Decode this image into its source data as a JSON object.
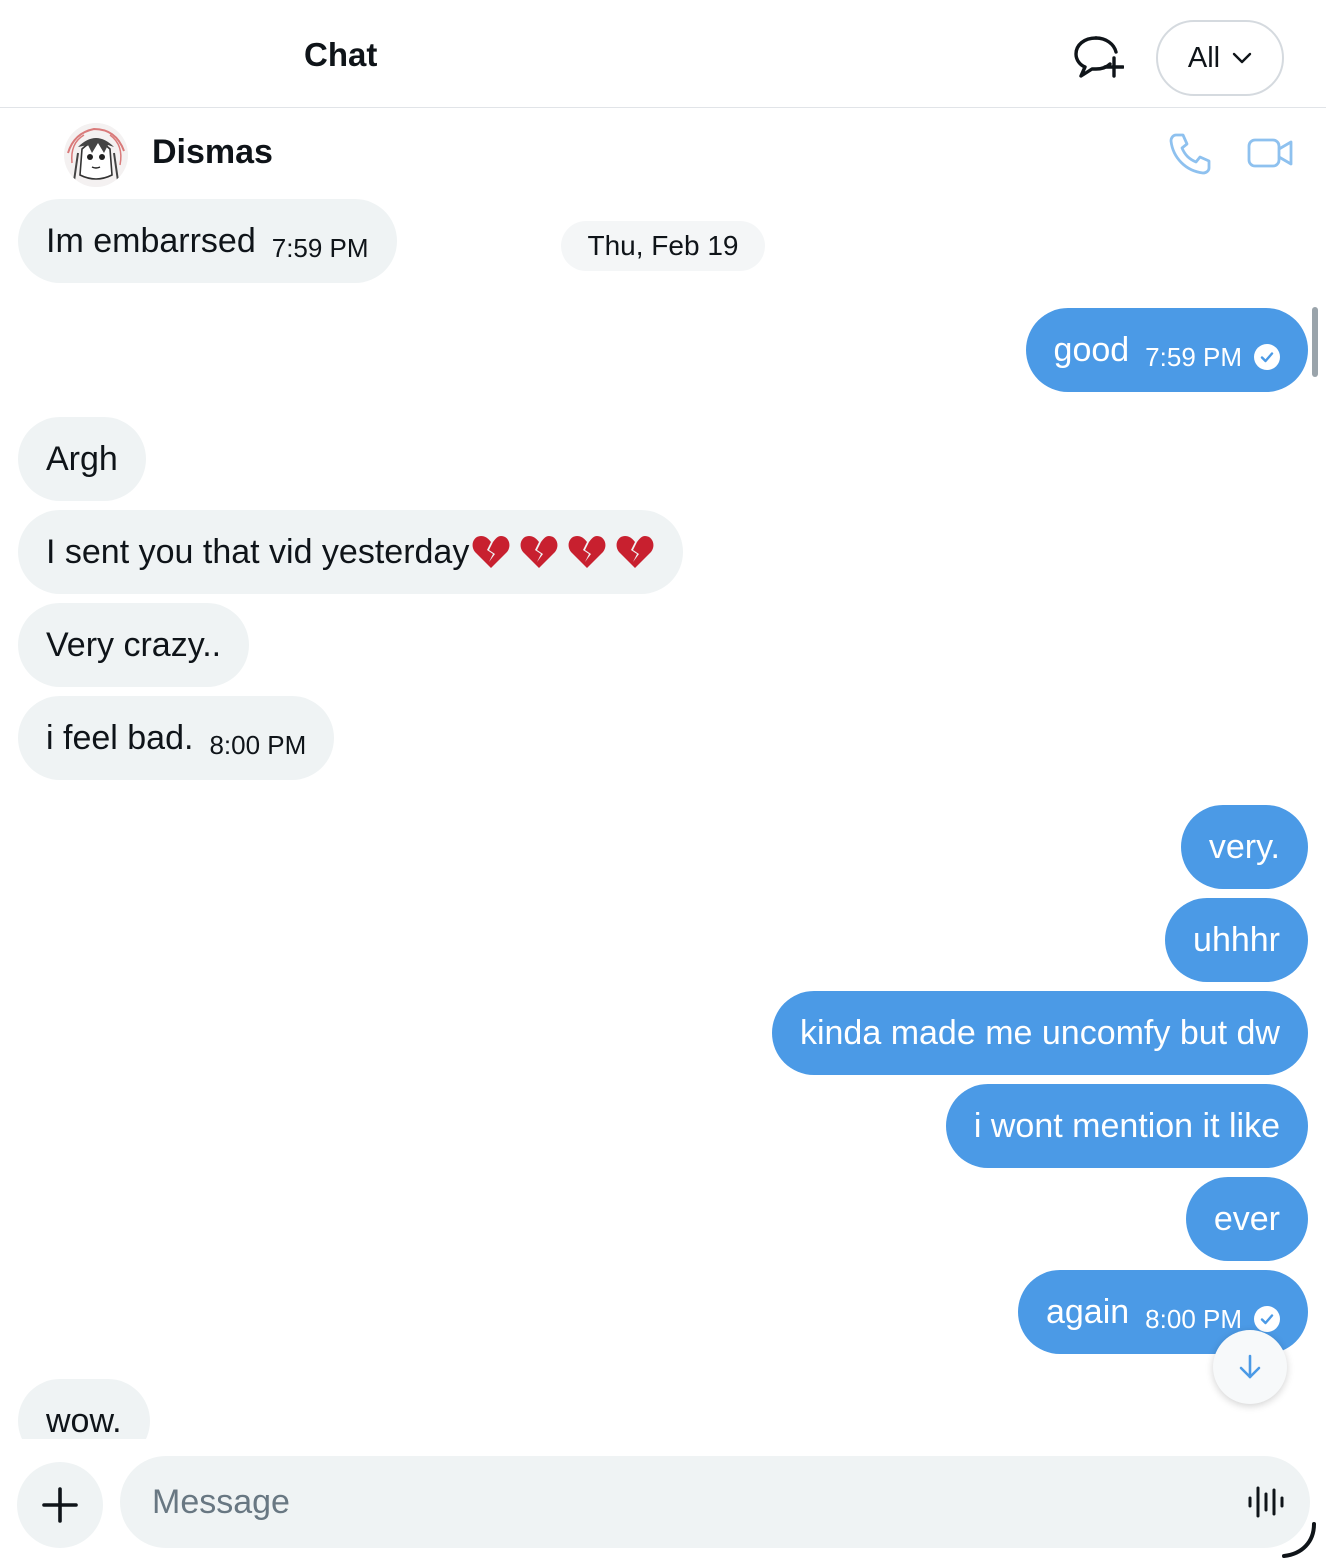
{
  "header": {
    "title": "Chat",
    "filter_label": "All"
  },
  "conversation": {
    "contact_name": "Dismas"
  },
  "date_chip": "Thu, Feb 19",
  "messages": [
    {
      "dir": "in",
      "text": "Im embarrsed",
      "time": "7:59 PM"
    },
    {
      "dir": "out",
      "text": "good",
      "time": "7:59 PM",
      "read": true
    },
    {
      "dir": "in",
      "text": "Argh"
    },
    {
      "dir": "in",
      "text": "I sent you that vid yesterday",
      "emoji": [
        "broken-heart",
        "broken-heart",
        "broken-heart",
        "broken-heart"
      ]
    },
    {
      "dir": "in",
      "text": "Very crazy.."
    },
    {
      "dir": "in",
      "text": "i feel bad.",
      "time": "8:00 PM"
    },
    {
      "dir": "out",
      "text": "very."
    },
    {
      "dir": "out",
      "text": "uhhhr"
    },
    {
      "dir": "out",
      "text": "kinda made me uncomfy but dw"
    },
    {
      "dir": "out",
      "text": "i wont mention it like"
    },
    {
      "dir": "out",
      "text": "ever"
    },
    {
      "dir": "out",
      "text": "again",
      "time": "8:00 PM",
      "read": true
    },
    {
      "dir": "in",
      "text": "wow."
    }
  ],
  "composer": {
    "placeholder": "Message"
  },
  "icons": {
    "new_chat": "new-message-icon",
    "filter_chevron": "chevron-down-icon",
    "call": "phone-icon",
    "video": "video-camera-icon",
    "read_receipt": "check-circle-icon",
    "emoji": "broken-heart-emoji",
    "scroll_down": "arrow-down-icon",
    "add": "plus-icon",
    "voice": "voice-waveform-icon"
  },
  "colors": {
    "outgoing_bubble": "#4b9ae6",
    "incoming_bubble": "#eff3f4",
    "accent_icon": "#8ec1ef",
    "primary_text": "#0f1419",
    "placeholder_text": "#687782"
  }
}
